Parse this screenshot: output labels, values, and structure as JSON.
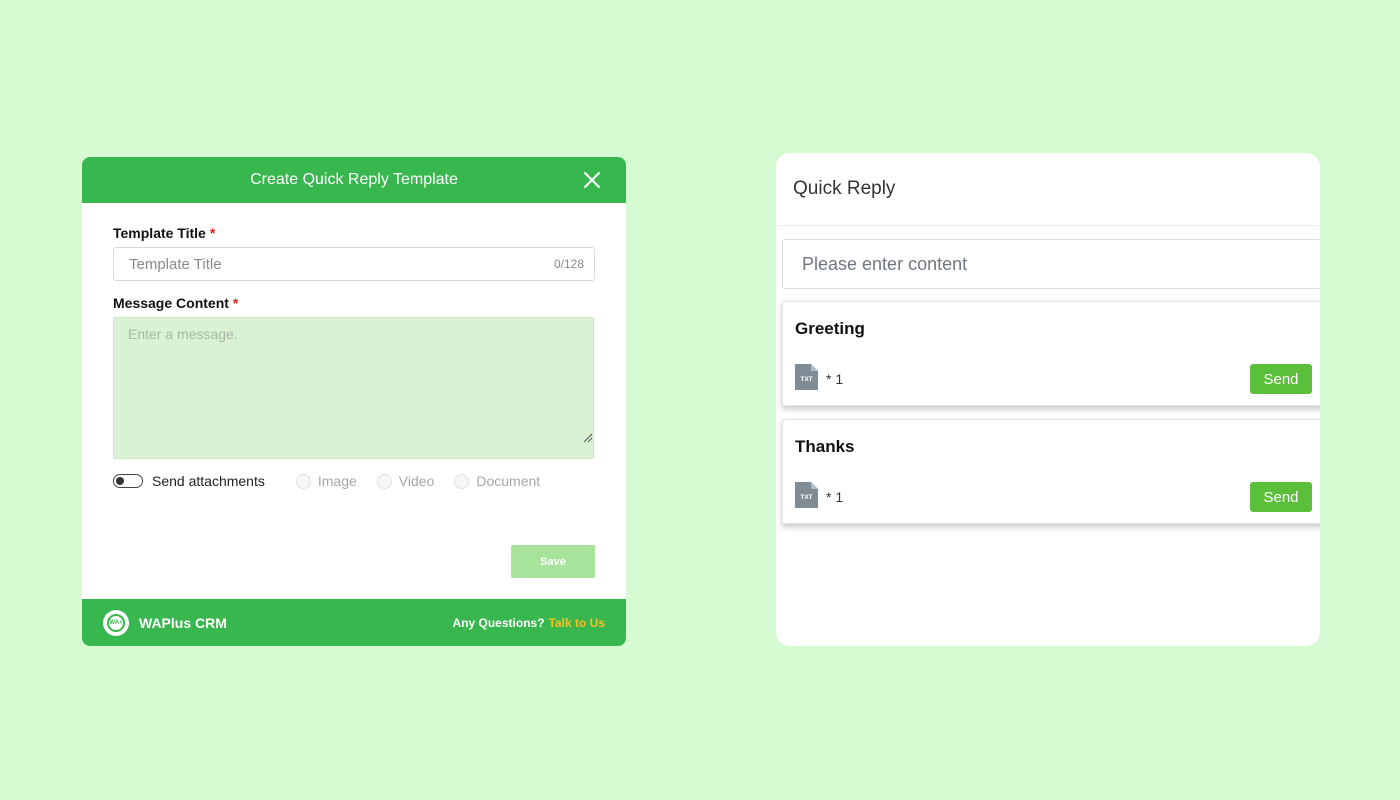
{
  "colors": {
    "background": "#d6fad1",
    "brand_green": "#39b74f",
    "send_green": "#5cbf3c",
    "save_disabled": "#a8e39b",
    "link_yellow": "#f5c02a"
  },
  "dialog": {
    "title": "Create Quick Reply Template",
    "close_icon": "close-icon",
    "template_title_label": "Template Title",
    "template_title_placeholder": "Template Title",
    "template_title_counter": "0/128",
    "message_content_label": "Message Content",
    "message_placeholder": "Enter a message.",
    "required_mark": "*",
    "send_attachments_label": "Send attachments",
    "send_attachments_enabled": false,
    "attachment_types": [
      "Image",
      "Video",
      "Document"
    ],
    "save_label": "Save",
    "footer": {
      "brand": "WAPlus CRM",
      "logo_text": "WA+",
      "question_text": "Any Questions?",
      "link_text": "Talk to Us"
    }
  },
  "quick_reply": {
    "title": "Quick Reply",
    "search_placeholder": "Please enter content",
    "items": [
      {
        "title": "Greeting",
        "file_type": "TXT",
        "count": "* 1",
        "send_label": "Send"
      },
      {
        "title": "Thanks",
        "file_type": "TXT",
        "count": "* 1",
        "send_label": "Send"
      }
    ]
  }
}
